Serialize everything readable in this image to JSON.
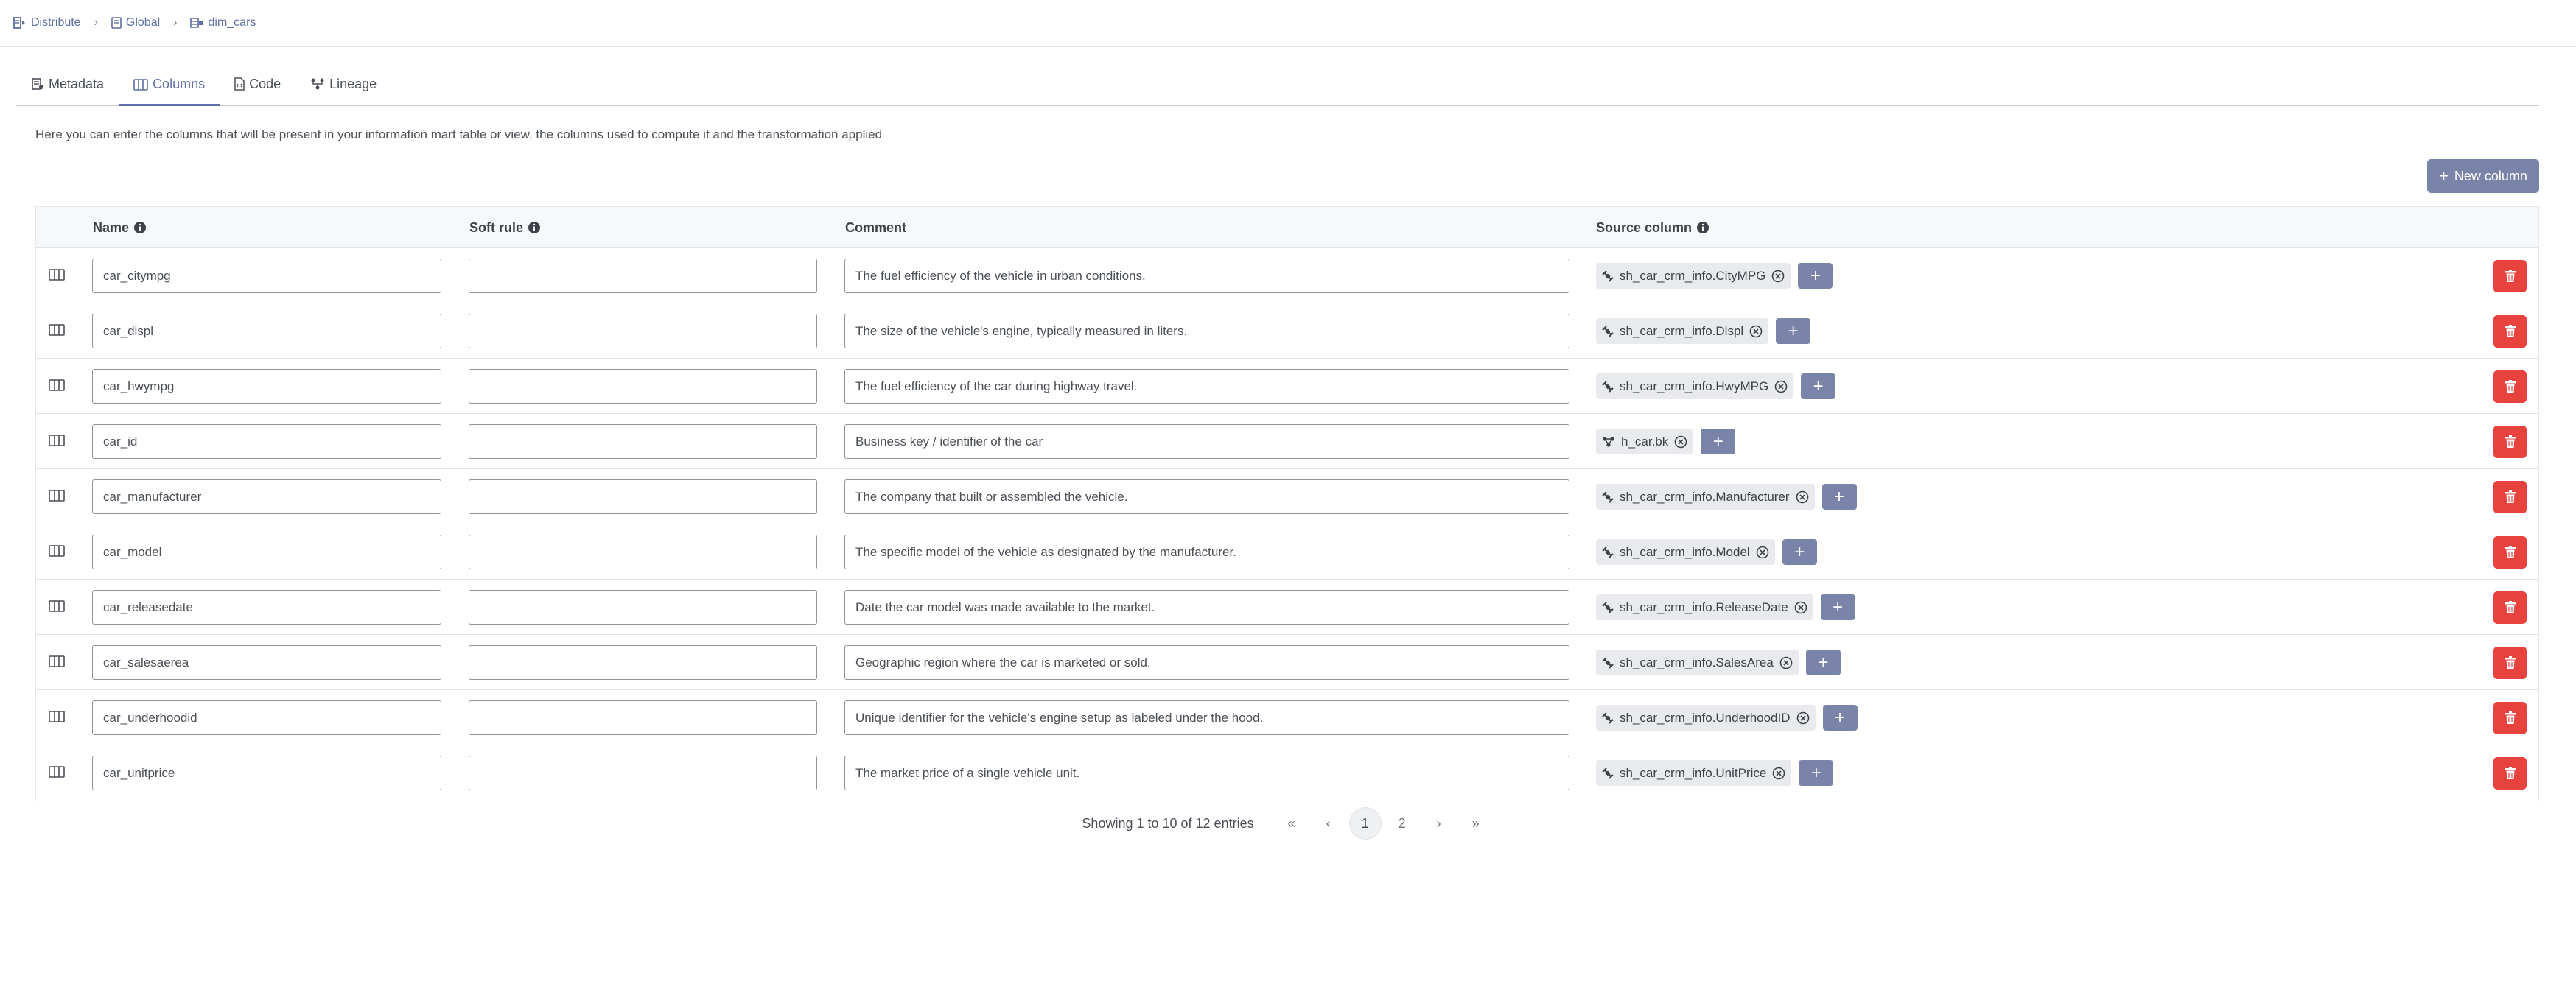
{
  "breadcrumb": [
    {
      "label": "Distribute",
      "icon": "distribute-icon"
    },
    {
      "label": "Global",
      "icon": "folder-icon"
    },
    {
      "label": "dim_cars",
      "icon": "table-icon"
    }
  ],
  "tabs": [
    {
      "label": "Metadata",
      "active": false
    },
    {
      "label": "Columns",
      "active": true
    },
    {
      "label": "Code",
      "active": false
    },
    {
      "label": "Lineage",
      "active": false
    }
  ],
  "description": "Here you can enter the columns that will be present in your information mart table or view, the columns used to compute it and the transformation applied",
  "new_column_label": "New column",
  "table": {
    "headers": {
      "name": "Name",
      "soft_rule": "Soft rule",
      "comment": "Comment",
      "source_column": "Source column"
    },
    "rows": [
      {
        "name": "car_citympg",
        "soft_rule": "",
        "comment": "The fuel efficiency of the vehicle in urban conditions.",
        "source": "sh_car_crm_info.CityMPG",
        "source_type": "satellite"
      },
      {
        "name": "car_displ",
        "soft_rule": "",
        "comment": "The size of the vehicle's engine, typically measured in liters.",
        "source": "sh_car_crm_info.Displ",
        "source_type": "satellite"
      },
      {
        "name": "car_hwympg",
        "soft_rule": "",
        "comment": "The fuel efficiency of the car during highway travel.",
        "source": "sh_car_crm_info.HwyMPG",
        "source_type": "satellite"
      },
      {
        "name": "car_id",
        "soft_rule": "",
        "comment": "Business key / identifier of the car",
        "source": "h_car.bk",
        "source_type": "hub"
      },
      {
        "name": "car_manufacturer",
        "soft_rule": "",
        "comment": "The company that built or assembled the vehicle.",
        "source": "sh_car_crm_info.Manufacturer",
        "source_type": "satellite"
      },
      {
        "name": "car_model",
        "soft_rule": "",
        "comment": "The specific model of the vehicle as designated by the manufacturer.",
        "source": "sh_car_crm_info.Model",
        "source_type": "satellite"
      },
      {
        "name": "car_releasedate",
        "soft_rule": "",
        "comment": "Date the car model was made available to the market.",
        "source": "sh_car_crm_info.ReleaseDate",
        "source_type": "satellite"
      },
      {
        "name": "car_salesaerea",
        "soft_rule": "",
        "comment": "Geographic region where the car is marketed or sold.",
        "source": "sh_car_crm_info.SalesArea",
        "source_type": "satellite"
      },
      {
        "name": "car_underhoodid",
        "soft_rule": "",
        "comment": "Unique identifier for the vehicle's engine setup as labeled under the hood.",
        "source": "sh_car_crm_info.UnderhoodID",
        "source_type": "satellite"
      },
      {
        "name": "car_unitprice",
        "soft_rule": "",
        "comment": "The market price of a single vehicle unit.",
        "source": "sh_car_crm_info.UnitPrice",
        "source_type": "satellite"
      }
    ]
  },
  "pagination": {
    "info": "Showing 1 to 10 of 12 entries",
    "first": "«",
    "prev": "‹",
    "pages": [
      "1",
      "2"
    ],
    "current": "1",
    "next": "›",
    "last": "»"
  },
  "colors": {
    "accent": "#5e6fa3",
    "button": "#7a84a8",
    "danger": "#e8423f"
  }
}
